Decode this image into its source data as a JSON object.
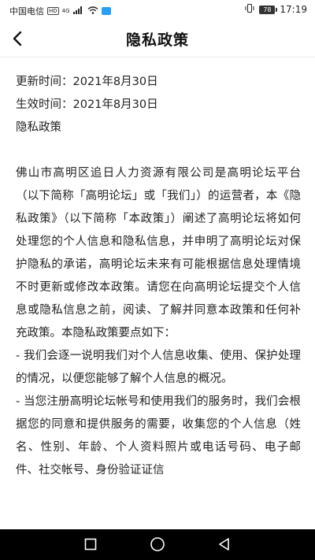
{
  "status_bar": {
    "carrier": "中国电信",
    "hd_badge": "HD",
    "network": "4G",
    "battery": "78",
    "time": "17:19"
  },
  "header": {
    "title": "隐私政策"
  },
  "content": {
    "updated_time": "更新时间：2021年8月30日",
    "effective_time": "生效时间：2021年8月30日",
    "doc_title": "隐私政策",
    "paragraphs": [
      "佛山市高明区追日人力资源有限公司是高明论坛平台（以下简称「高明论坛」或「我们」）的运营者，本《隐私政策》（以下简称「本政策」）阐述了高明论坛将如何处理您的个人信息和隐私信息，并申明了高明论坛对保护隐私的承诺，高明论坛未来有可能根据信息处理情境不时更新或修改本政策。请您在向高明论坛提交个人信息或隐私信息之前，阅读、了解并同意本政策和任何补充政策。本隐私政策要点如下：",
      "- 我们会逐一说明我们对个人信息收集、使用、保护处理的情况，以便您能够了解个人信息的概况。",
      "- 当您注册高明论坛帐号和使用我们的服务时，我们会根据您的同意和提供服务的需要，收集您的个人信息（姓名、性别、年龄、个人资料照片或电话号码、电子邮件、社交帐号、身份验证证信"
    ]
  },
  "colors": {
    "nav_bar": "#000000",
    "text": "#222222",
    "background": "#ffffff"
  }
}
